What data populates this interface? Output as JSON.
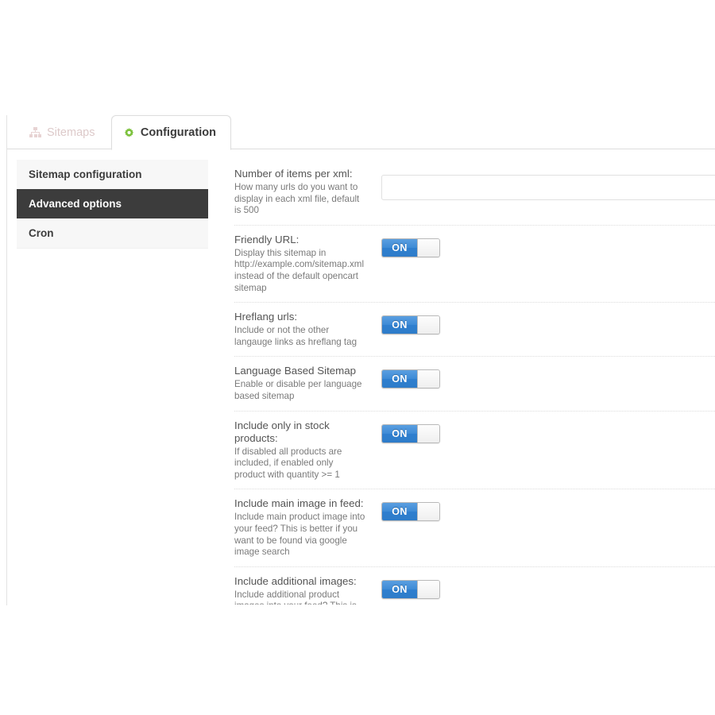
{
  "tabs": [
    {
      "label": "Sitemaps",
      "icon": "sitemap-icon",
      "active": false
    },
    {
      "label": "Configuration",
      "icon": "gear-icon",
      "active": true
    }
  ],
  "sidebar": {
    "items": [
      {
        "label": "Sitemap configuration",
        "active": false
      },
      {
        "label": "Advanced options",
        "active": true
      },
      {
        "label": "Cron",
        "active": false
      }
    ]
  },
  "colors": {
    "accent_green": "#7cc13c",
    "toggle_blue": "#3d8ad6",
    "active_sidebar_bg": "#3c3c3c"
  },
  "settings": [
    {
      "title": "Number of items per xml:",
      "description": "How many urls do you want to display in each xml file, default is 500",
      "control": "text",
      "value": "",
      "placeholder": ""
    },
    {
      "title": "Friendly URL:",
      "description": "Display this sitemap in http://example.com/sitemap.xml instead of the default opencart sitemap",
      "control": "toggle",
      "value": "ON"
    },
    {
      "title": "Hreflang urls:",
      "description": "Include or not the other langauge links as hreflang tag",
      "control": "toggle",
      "value": "ON"
    },
    {
      "title": "Language Based Sitemap",
      "description": "Enable or disable per language based sitemap",
      "control": "toggle",
      "value": "ON"
    },
    {
      "title": "Include only in stock products:",
      "description": "If disabled all products are included, if enabled only product with quantity >= 1",
      "control": "toggle",
      "value": "ON"
    },
    {
      "title": "Include main image in feed:",
      "description": "Include main product image into your feed? This is better if you want to be found via google image search",
      "control": "toggle",
      "value": "ON"
    },
    {
      "title": "Include additional images:",
      "description": "Include additional product images into your feed? This is better if you want to be found via google image",
      "control": "toggle",
      "value": "ON"
    }
  ]
}
